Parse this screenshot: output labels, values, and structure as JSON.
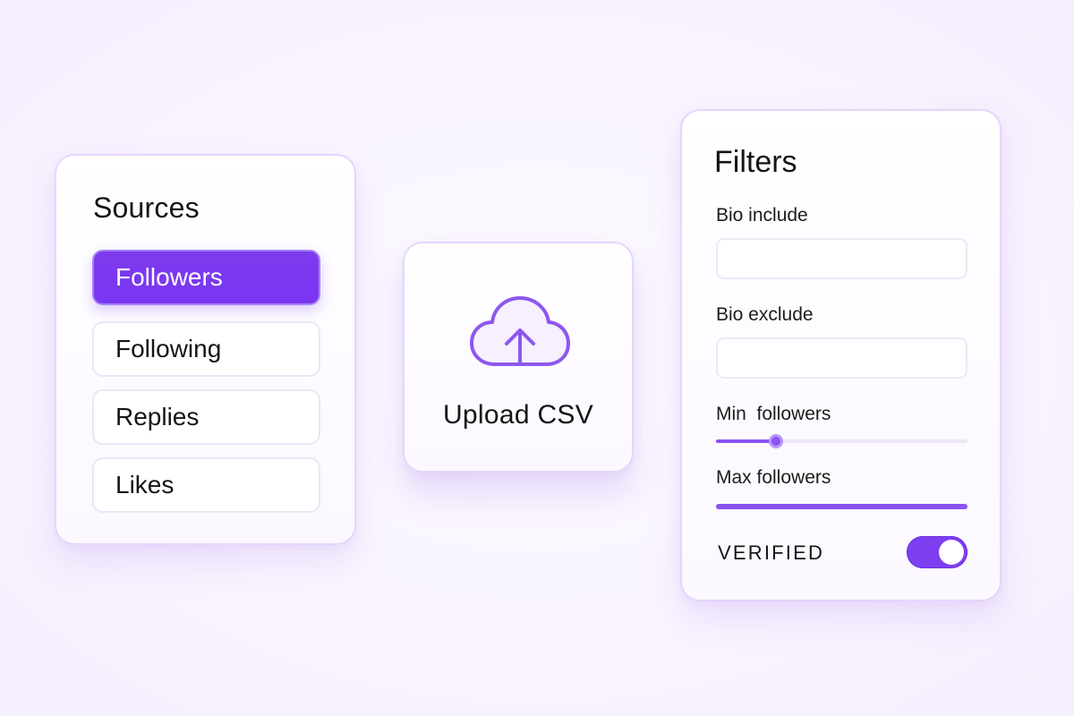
{
  "sources": {
    "title": "Sources",
    "items": [
      {
        "label": "Followers",
        "active": true
      },
      {
        "label": "Following",
        "active": false
      },
      {
        "label": "Replies",
        "active": false
      },
      {
        "label": "Likes",
        "active": false
      }
    ]
  },
  "upload": {
    "icon": "cloud-upload-icon",
    "label": "Upload CSV"
  },
  "filters": {
    "title": "Filters",
    "bio_include": {
      "label": "Bio include",
      "value": ""
    },
    "bio_exclude": {
      "label": "Bio exclude",
      "value": ""
    },
    "min_followers": {
      "label": "Min  followers",
      "level_percent": 24
    },
    "max_followers": {
      "label": "Max followers",
      "level_percent": 100
    },
    "verified": {
      "label": "VERIFIED",
      "on": true
    }
  },
  "colors": {
    "accent": "#7c3aed",
    "card_border": "#e4d6fb",
    "background": "#faf6ff"
  }
}
